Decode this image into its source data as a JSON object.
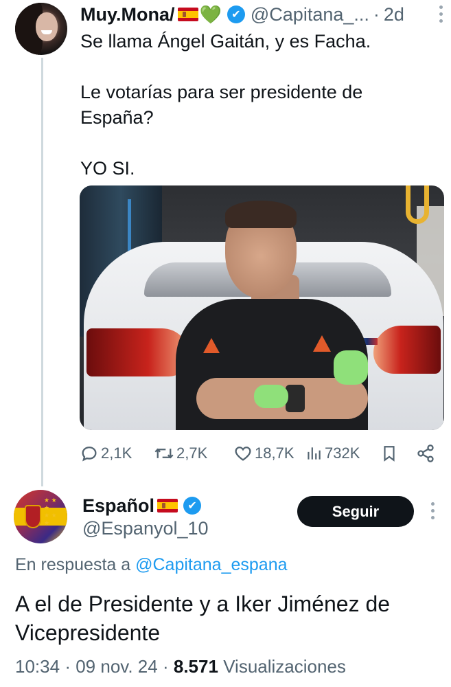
{
  "first_tweet": {
    "display_name": "Muy.Mona/",
    "heart_emoji": "💚",
    "verified_icon": "✔",
    "handle": "@Capitana_...",
    "separator": "·",
    "age": "2d",
    "text_lines": [
      "Se llama Ángel Gaitán, y es Facha.",
      "",
      "Le votarías para ser presidente de",
      "España?",
      "",
      "YO SI."
    ],
    "image_icon": "photo-man-with-car",
    "actions": {
      "replies": "2,1K",
      "retweets": "2,7K",
      "likes": "18,7K",
      "views": "732K"
    }
  },
  "second_tweet": {
    "display_name": "Español",
    "verified_icon": "✔",
    "handle": "@Espanyol_10",
    "follow_label": "Seguir",
    "reply_prefix": "En respuesta a",
    "reply_mention": "@Capitana_espana",
    "text": "A el de Presidente y a Iker Jiménez de Vicepresidente",
    "time": "10:34",
    "sep1": "·",
    "date": "09 nov. 24",
    "sep2": "·",
    "views_count": "8.571",
    "views_label": "Visualizaciones"
  },
  "colors": {
    "text": "#0f1419",
    "secondary": "#536471",
    "accent": "#1d9bf0",
    "button_bg": "#0f1419",
    "thread_line": "#cfd9de"
  }
}
